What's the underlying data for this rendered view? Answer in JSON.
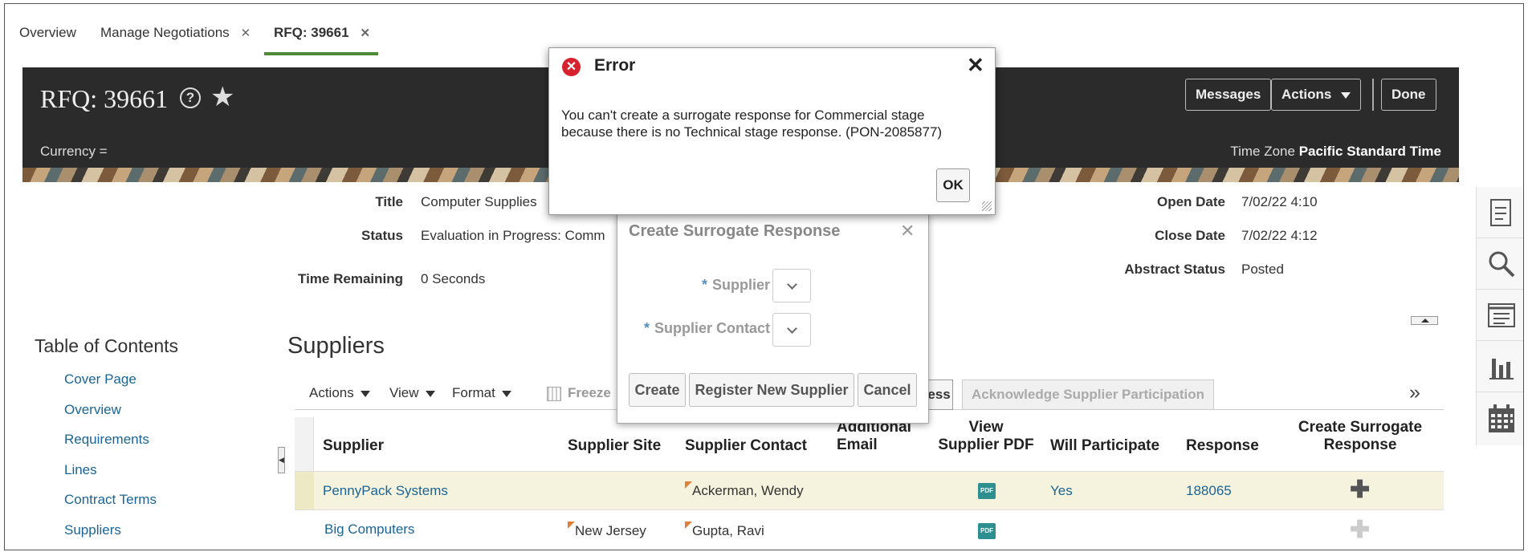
{
  "tabs": {
    "items": [
      {
        "label": "Overview"
      },
      {
        "label": "Manage Negotiations"
      },
      {
        "label": "RFQ: 39661"
      }
    ]
  },
  "header": {
    "title": "RFQ: 39661",
    "currency_label": "Currency =",
    "timezone_label": "Time Zone",
    "timezone_value": "Pacific Standard Time",
    "messages_label": "Messages",
    "actions_label": "Actions",
    "done_label": "Done"
  },
  "details": {
    "title_label": "Title",
    "title_value": "Computer Supplies",
    "status_label": "Status",
    "status_value": "Evaluation in Progress: Comm",
    "time_remaining_label": "Time Remaining",
    "time_remaining_value": "0 Seconds",
    "open_date_label": "Open Date",
    "open_date_value": "7/02/22 4:10",
    "close_date_label": "Close Date",
    "close_date_value": "7/02/22 4:12",
    "abstract_status_label": "Abstract Status",
    "abstract_status_value": "Posted"
  },
  "toc": {
    "title": "Table of Contents",
    "items": [
      {
        "label": "Cover Page"
      },
      {
        "label": "Overview"
      },
      {
        "label": "Requirements"
      },
      {
        "label": "Lines"
      },
      {
        "label": "Contract Terms"
      },
      {
        "label": "Suppliers"
      }
    ]
  },
  "suppliers": {
    "title": "Suppliers",
    "toolbar": {
      "actions": "Actions",
      "view": "View",
      "format": "Format",
      "freeze": "Freeze",
      "partial_button": "ess",
      "acknowledge": "Acknowledge Supplier Participation"
    },
    "columns": {
      "supplier": "Supplier",
      "site": "Supplier Site",
      "contact": "Supplier Contact",
      "email_1": "Additional",
      "email_2": "Email",
      "pdf_1": "View",
      "pdf_2": "Supplier PDF",
      "participate": "Will Participate",
      "response": "Response",
      "surrogate_1": "Create Surrogate",
      "surrogate_2": "Response"
    },
    "rows": [
      {
        "supplier": "PennyPack Systems",
        "site": "",
        "contact": "Ackerman, Wendy",
        "email": "",
        "pdf": "PDF",
        "participate": "Yes",
        "response": "188065"
      },
      {
        "supplier": "Big Computers",
        "site": "New Jersey",
        "contact": "Gupta, Ravi",
        "email": "",
        "pdf": "PDF",
        "participate": "",
        "response": ""
      }
    ]
  },
  "surrogate_dialog": {
    "title": "Create Surrogate Response",
    "supplier_label": "Supplier",
    "contact_label": "Supplier Contact",
    "required_mark": "*",
    "create_label": "Create",
    "register_label": "Register New Supplier",
    "cancel_label": "Cancel"
  },
  "error_dialog": {
    "title": "Error",
    "message": "You can't create a surrogate response for Commercial stage because there is no Technical stage response. (PON-2085877)",
    "ok_label": "OK"
  },
  "icons": {
    "tab_close": "close-icon",
    "help": "help-icon",
    "favorite": "star-icon",
    "error": "error-icon",
    "pdf": "pdf-icon",
    "add": "plus-icon",
    "right_panel": [
      "document-icon",
      "search-icon",
      "list-icon",
      "bar-chart-icon",
      "calendar-icon"
    ]
  },
  "colors": {
    "accent_tab": "#4e8a36",
    "header_bg": "#2b2b2b",
    "link": "#1a6495",
    "error": "#d6222f",
    "row_highlight": "#f5f3dd"
  }
}
